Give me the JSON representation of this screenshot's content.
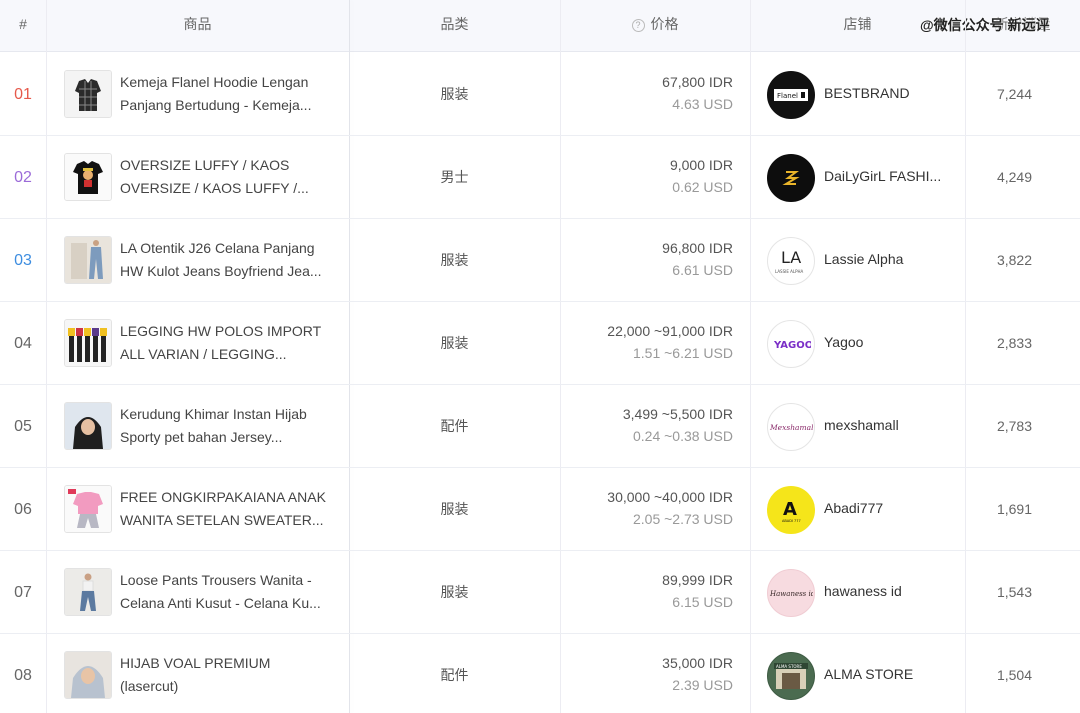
{
  "header": {
    "rank": "#",
    "product": "商品",
    "category": "品类",
    "price": "价格",
    "store": "店铺",
    "sales": "新增销量"
  },
  "watermark": "@微信公众号 新远评",
  "rows": [
    {
      "rank": "01",
      "title1": "Kemeja Flanel Hoodie Lengan",
      "title2": "Panjang Bertudung - Kemeja...",
      "category": "服装",
      "idr": "67,800 IDR",
      "usd": "4.63 USD",
      "store": "BESTBRAND",
      "sales": "7,244"
    },
    {
      "rank": "02",
      "title1": "OVERSIZE LUFFY / KAOS",
      "title2": "OVERSIZE / KAOS LUFFY /...",
      "category": "男士",
      "idr": "9,000 IDR",
      "usd": "0.62 USD",
      "store": "DaiLyGirL FASHI...",
      "sales": "4,249"
    },
    {
      "rank": "03",
      "title1": "LA Otentik J26 Celana Panjang",
      "title2": "HW Kulot Jeans Boyfriend Jea...",
      "category": "服装",
      "idr": "96,800 IDR",
      "usd": "6.61 USD",
      "store": "Lassie Alpha",
      "sales": "3,822"
    },
    {
      "rank": "04",
      "title1": "LEGGING HW POLOS IMPORT",
      "title2": "ALL VARIAN / LEGGING...",
      "category": "服装",
      "idr": "22,000 ~91,000 IDR",
      "usd": "1.51 ~6.21 USD",
      "store": "Yagoo",
      "sales": "2,833"
    },
    {
      "rank": "05",
      "title1": "Kerudung Khimar Instan Hijab",
      "title2": "Sporty pet bahan Jersey...",
      "category": "配件",
      "idr": "3,499 ~5,500 IDR",
      "usd": "0.24 ~0.38 USD",
      "store": "mexshamall",
      "sales": "2,783"
    },
    {
      "rank": "06",
      "title1": "FREE ONGKIRPAKAIANA ANAK",
      "title2": "WANITA SETELAN SWEATER...",
      "category": "服装",
      "idr": "30,000 ~40,000 IDR",
      "usd": "2.05 ~2.73 USD",
      "store": "Abadi777",
      "sales": "1,691"
    },
    {
      "rank": "07",
      "title1": "Loose Pants Trousers Wanita -",
      "title2": "Celana Anti Kusut - Celana Ku...",
      "category": "服装",
      "idr": "89,999 IDR",
      "usd": "6.15 USD",
      "store": "hawaness id",
      "sales": "1,543"
    },
    {
      "rank": "08",
      "title1": "HIJAB VOAL PREMIUM",
      "title2": "(lasercut)",
      "category": "配件",
      "idr": "35,000 IDR",
      "usd": "2.39 USD",
      "store": "ALMA STORE",
      "sales": "1,504"
    }
  ],
  "logos": {
    "bestbrand": "Flanel",
    "lassie": "LA",
    "lassie_sub": "LASSIE ALPHA",
    "yagoo": "YAGOO",
    "mexshamall": "Mexshamall",
    "abadi": "A",
    "abadi_sub": "ABADI 777",
    "hawaness": "Hawaness id",
    "alma": "ALMA STORE"
  },
  "colors": {
    "rank1": "#e6594b",
    "rank2": "#9b6bd8",
    "rank3": "#3d8de0",
    "header_bg": "#f7f8fc"
  }
}
